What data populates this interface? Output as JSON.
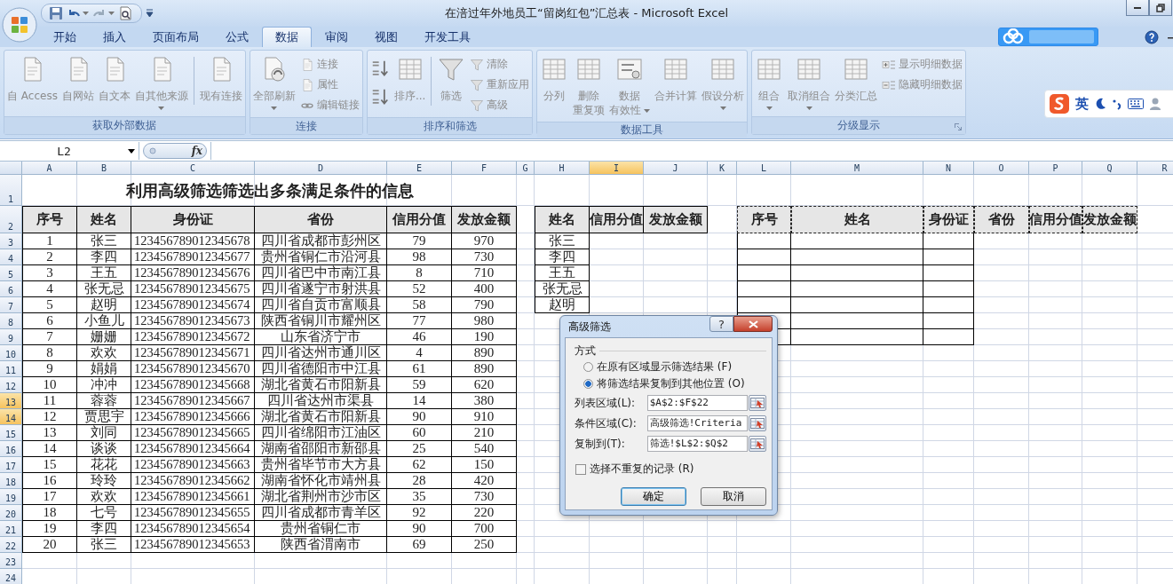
{
  "window": {
    "title": "在涪过年外地员工“留岗红包”汇总表 - Microsoft Excel"
  },
  "tabs": [
    {
      "label": "开始",
      "selected": false
    },
    {
      "label": "插入",
      "selected": false
    },
    {
      "label": "页面布局",
      "selected": false
    },
    {
      "label": "公式",
      "selected": false
    },
    {
      "label": "数据",
      "selected": true
    },
    {
      "label": "审阅",
      "selected": false
    },
    {
      "label": "视图",
      "selected": false
    },
    {
      "label": "开发工具",
      "selected": false
    }
  ],
  "ribbon": {
    "disabled": true,
    "groups": [
      {
        "label": "获取外部数据",
        "launcher": false,
        "items": [
          {
            "kind": "large",
            "lines": [
              "自 Access"
            ],
            "menu": false
          },
          {
            "kind": "large",
            "lines": [
              "自网站"
            ],
            "menu": false
          },
          {
            "kind": "large",
            "lines": [
              "自文本"
            ],
            "menu": false
          },
          {
            "kind": "large",
            "lines": [
              "自其他来源"
            ],
            "menu": true
          },
          {
            "kind": "separator"
          },
          {
            "kind": "large",
            "lines": [
              "现有连接"
            ],
            "menu": false
          }
        ]
      },
      {
        "label": "连接",
        "launcher": false,
        "items": [
          {
            "kind": "large",
            "lines": [
              "全部刷新"
            ],
            "menu": true
          },
          {
            "kind": "stack",
            "items": [
              {
                "kind": "small",
                "label": "连接"
              },
              {
                "kind": "small",
                "label": "属性"
              },
              {
                "kind": "small",
                "label": "编辑链接"
              }
            ]
          }
        ]
      },
      {
        "label": "排序和筛选",
        "launcher": false,
        "items": [
          {
            "kind": "stack",
            "items": [
              {
                "kind": "icon"
              },
              {
                "kind": "icon"
              }
            ]
          },
          {
            "kind": "large",
            "lines": [
              "排序..."
            ],
            "menu": false
          },
          {
            "kind": "separator"
          },
          {
            "kind": "large",
            "lines": [
              "筛选"
            ],
            "menu": false
          },
          {
            "kind": "stack",
            "items": [
              {
                "kind": "small",
                "label": "清除"
              },
              {
                "kind": "small",
                "label": "重新应用"
              },
              {
                "kind": "small",
                "label": "高级"
              }
            ]
          }
        ]
      },
      {
        "label": "数据工具",
        "launcher": false,
        "items": [
          {
            "kind": "large",
            "lines": [
              "分列"
            ],
            "menu": false
          },
          {
            "kind": "large",
            "lines": [
              "删除",
              "重复项"
            ],
            "menu": false
          },
          {
            "kind": "large",
            "lines": [
              "数据",
              "有效性"
            ],
            "menu": true
          },
          {
            "kind": "large",
            "lines": [
              "合并计算"
            ],
            "menu": false
          },
          {
            "kind": "large",
            "lines": [
              "假设分析"
            ],
            "menu": true
          }
        ]
      },
      {
        "label": "分级显示",
        "launcher": true,
        "items": [
          {
            "kind": "large",
            "lines": [
              "组合"
            ],
            "menu": true
          },
          {
            "kind": "large",
            "lines": [
              "取消组合"
            ],
            "menu": true
          },
          {
            "kind": "large",
            "lines": [
              "分类汇总"
            ],
            "menu": false
          },
          {
            "kind": "stack",
            "items": [
              {
                "kind": "small",
                "label": "显示明细数据"
              },
              {
                "kind": "small",
                "label": "隐藏明细数据"
              }
            ]
          }
        ]
      }
    ]
  },
  "ime_bar": {
    "mode": "英"
  },
  "formula_bar": {
    "name_box": "L2",
    "function_label": "fx"
  },
  "sheet": {
    "columns": [
      {
        "label": "A",
        "highlighted": false
      },
      {
        "label": "B",
        "highlighted": false
      },
      {
        "label": "C",
        "highlighted": false
      },
      {
        "label": "D",
        "highlighted": false
      },
      {
        "label": "E",
        "highlighted": false
      },
      {
        "label": "F",
        "highlighted": false
      },
      {
        "label": "G",
        "highlighted": false
      },
      {
        "label": "H",
        "highlighted": false
      },
      {
        "label": "I",
        "highlighted": true
      },
      {
        "label": "J",
        "highlighted": false
      },
      {
        "label": "K",
        "highlighted": false
      },
      {
        "label": "L",
        "highlighted": false
      },
      {
        "label": "M",
        "highlighted": false
      },
      {
        "label": "N",
        "highlighted": false
      },
      {
        "label": "O",
        "highlighted": false
      },
      {
        "label": "P",
        "highlighted": false
      },
      {
        "label": "Q",
        "highlighted": false
      },
      {
        "label": "R",
        "highlighted": false
      }
    ],
    "rows": [
      {
        "label": "1",
        "highlighted": false
      },
      {
        "label": "2",
        "highlighted": false
      },
      {
        "label": "3",
        "highlighted": false
      },
      {
        "label": "4",
        "highlighted": false
      },
      {
        "label": "5",
        "highlighted": false
      },
      {
        "label": "6",
        "highlighted": false
      },
      {
        "label": "7",
        "highlighted": false
      },
      {
        "label": "8",
        "highlighted": false
      },
      {
        "label": "9",
        "highlighted": false
      },
      {
        "label": "10",
        "highlighted": false
      },
      {
        "label": "11",
        "highlighted": false
      },
      {
        "label": "12",
        "highlighted": false
      },
      {
        "label": "13",
        "highlighted": true
      },
      {
        "label": "14",
        "highlighted": true
      },
      {
        "label": "15",
        "highlighted": false
      },
      {
        "label": "16",
        "highlighted": false
      },
      {
        "label": "17",
        "highlighted": false
      },
      {
        "label": "18",
        "highlighted": false
      },
      {
        "label": "19",
        "highlighted": false
      },
      {
        "label": "20",
        "highlighted": false
      },
      {
        "label": "21",
        "highlighted": false
      },
      {
        "label": "22",
        "highlighted": false
      },
      {
        "label": "23",
        "highlighted": false
      },
      {
        "label": "24",
        "highlighted": false
      }
    ],
    "title": "利用高级筛选筛选出多条满足条件的信息",
    "main_table": {
      "columns": [
        "序号",
        "姓名",
        "身份证",
        "省份",
        "信用分值",
        "发放金额"
      ],
      "rows": [
        [
          "1",
          "张三",
          "123456789012345678",
          "四川省成都市彭州区",
          "79",
          "970"
        ],
        [
          "2",
          "李四",
          "123456789012345677",
          "贵州省铜仁市沿河县",
          "98",
          "730"
        ],
        [
          "3",
          "王五",
          "123456789012345676",
          "四川省巴中市南江县",
          "8",
          "710"
        ],
        [
          "4",
          "张无忌",
          "123456789012345675",
          "四川省遂宁市射洪县",
          "52",
          "400"
        ],
        [
          "5",
          "赵明",
          "123456789012345674",
          "四川省自贡市富顺县",
          "58",
          "790"
        ],
        [
          "6",
          "小鱼儿",
          "123456789012345673",
          "陕西省铜川市耀州区",
          "77",
          "980"
        ],
        [
          "7",
          "姗姗",
          "123456789012345672",
          "山东省济宁市",
          "46",
          "190"
        ],
        [
          "8",
          "欢欢",
          "123456789012345671",
          "四川省达州市通川区",
          "4",
          "890"
        ],
        [
          "9",
          "娟娟",
          "123456789012345670",
          "四川省德阳市中江县",
          "61",
          "890"
        ],
        [
          "10",
          "冲冲",
          "123456789012345668",
          "湖北省黄石市阳新县",
          "59",
          "620"
        ],
        [
          "11",
          "蓉蓉",
          "123456789012345667",
          "四川省达州市渠县",
          "14",
          "380"
        ],
        [
          "12",
          "贾思宇",
          "123456789012345666",
          "湖北省黄石市阳新县",
          "90",
          "910"
        ],
        [
          "13",
          "刘同",
          "123456789012345665",
          "四川省绵阳市江油区",
          "60",
          "210"
        ],
        [
          "14",
          "谈谈",
          "123456789012345664",
          "湖南省邵阳市新邵县",
          "25",
          "540"
        ],
        [
          "15",
          "花花",
          "123456789012345663",
          "贵州省毕节市大方县",
          "62",
          "150"
        ],
        [
          "16",
          "玲玲",
          "123456789012345662",
          "湖南省怀化市靖州县",
          "28",
          "420"
        ],
        [
          "17",
          "欢欢",
          "123456789012345661",
          "湖北省荆州市沙市区",
          "35",
          "730"
        ],
        [
          "18",
          "七号",
          "123456789012345655",
          "四川省成都市青羊区",
          "92",
          "220"
        ],
        [
          "19",
          "李四",
          "123456789012345654",
          "贵州省铜仁市",
          "90",
          "700"
        ],
        [
          "20",
          "张三",
          "123456789012345653",
          "陕西省渭南市",
          "69",
          "250"
        ]
      ]
    },
    "criteria_table": {
      "columns": [
        "姓名",
        "信用分值",
        "发放金额"
      ],
      "rows": [
        [
          "张三"
        ],
        [
          "李四"
        ],
        [
          "王五"
        ],
        [
          "张无忌"
        ],
        [
          "赵明"
        ]
      ]
    },
    "output_table": {
      "columns": [
        "序号",
        "姓名",
        "身份证",
        "省份",
        "信用分值",
        "发放金额"
      ],
      "marquee": true
    }
  },
  "dialog": {
    "title": "高级筛选",
    "help_glyph": "?",
    "section": "方式",
    "options": [
      {
        "label": "在原有区域显示筛选结果 (F)",
        "selected": false
      },
      {
        "label": "将筛选结果复制到其他位置 (O)",
        "selected": true
      }
    ],
    "fields": [
      {
        "label": "列表区域(L):",
        "value": "$A$2:$F$22"
      },
      {
        "label": "条件区域(C):",
        "value": "高级筛选!Criteria"
      },
      {
        "label": "复制到(T):",
        "value": "筛选!$L$2:$Q$2"
      }
    ],
    "checkbox": {
      "label": "选择不重复的记录 (R)",
      "checked": false
    },
    "buttons": [
      {
        "label": "确定",
        "focused": true
      },
      {
        "label": "取消",
        "focused": false
      }
    ]
  }
}
